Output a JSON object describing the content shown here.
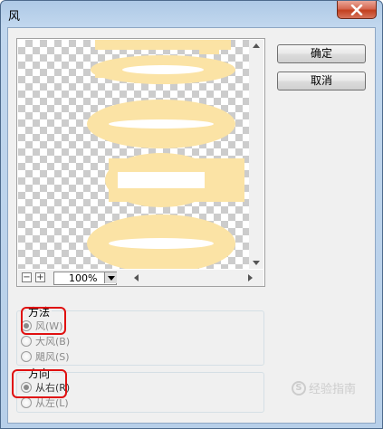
{
  "window": {
    "title": "风"
  },
  "preview": {
    "zoom_out_symbol": "−",
    "zoom_in_symbol": "+",
    "zoom_value": "100%"
  },
  "buttons": {
    "ok_label": "确定",
    "cancel_label": "取消"
  },
  "method_group": {
    "title": "方法",
    "options": [
      {
        "label": "风(W)",
        "checked": true
      },
      {
        "label": "大风(B)",
        "checked": false
      },
      {
        "label": "飓风(S)",
        "checked": false
      }
    ]
  },
  "direction_group": {
    "title": "方向",
    "options": [
      {
        "label": "从右(R)",
        "checked": true
      },
      {
        "label": "从左(L)",
        "checked": false
      }
    ]
  },
  "watermark": {
    "logo_letter": "S",
    "text": "经验指南"
  },
  "colors": {
    "shape_fill": "#fbe3a5",
    "highlight_box": "#e01010"
  }
}
